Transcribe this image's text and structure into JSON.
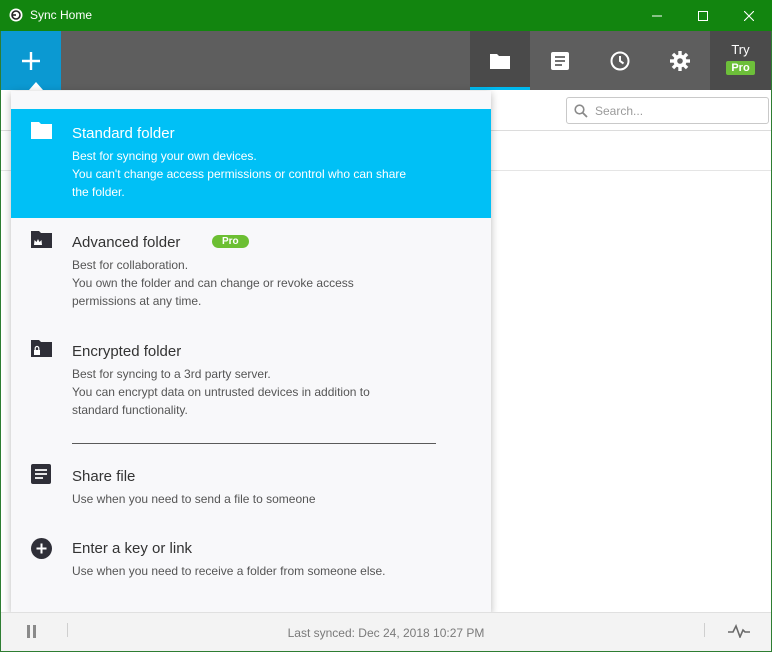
{
  "window": {
    "title": "Sync Home"
  },
  "toolbar": {
    "try_label": "Try",
    "pro_label": "Pro"
  },
  "search": {
    "placeholder": "Search..."
  },
  "menu": {
    "items": [
      {
        "icon": "folder-icon",
        "title": "Standard folder",
        "description": [
          "Best for syncing your own devices.",
          "You can't change access permissions or control who can share",
          "the folder."
        ],
        "selected": true
      },
      {
        "icon": "crown-folder-icon",
        "title": "Advanced folder",
        "badge": "Pro",
        "description": [
          "Best for collaboration.",
          "You own the folder and can change or revoke access",
          "permissions at any time."
        ]
      },
      {
        "icon": "lock-folder-icon",
        "title": "Encrypted folder",
        "description": [
          "Best for syncing to a 3rd party server.",
          "You can encrypt data on untrusted devices in addition to",
          "standard functionality."
        ]
      },
      {
        "icon": "document-icon",
        "title": "Share file",
        "description": [
          "Use when you need to send a file to someone"
        ]
      },
      {
        "icon": "plus-circle-icon",
        "title": "Enter a key or link",
        "description": [
          "Use when you need to receive a folder from someone else."
        ]
      }
    ]
  },
  "status": {
    "last_synced": "Last synced: Dec 24, 2018 10:27 PM"
  },
  "colors": {
    "titlebar": "#12850f",
    "accent": "#0b99d2",
    "selected": "#00c0f6",
    "pro": "#6cbf33"
  }
}
